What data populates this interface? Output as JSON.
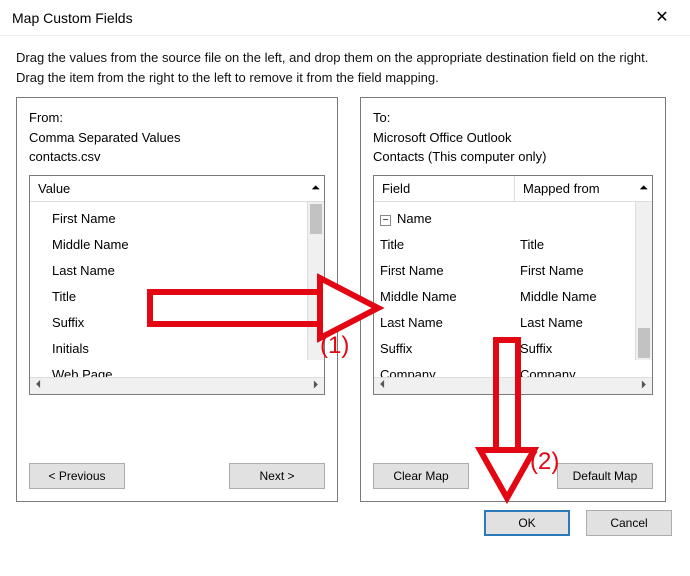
{
  "window": {
    "title": "Map Custom Fields",
    "close_icon": "✕"
  },
  "instructions": "Drag the values from the source file on the left, and drop them on the appropriate destination field on the right.  Drag the item from the right to the left to remove it from the field mapping.",
  "from": {
    "label": "From:",
    "format": "Comma Separated Values",
    "file": "contacts.csv",
    "col_header": "Value",
    "items": [
      "First Name",
      "Middle Name",
      "Last Name",
      "Title",
      "Suffix",
      "Initials",
      "Web Page"
    ]
  },
  "to": {
    "label": "To:",
    "app": "Microsoft Office Outlook",
    "folder": "Contacts (This computer only)",
    "col_field": "Field",
    "col_mapped": "Mapped from",
    "root": "Name",
    "rows": [
      {
        "field": "Title",
        "mapped": "Title"
      },
      {
        "field": "First Name",
        "mapped": "First Name"
      },
      {
        "field": "Middle Name",
        "mapped": "Middle Name"
      },
      {
        "field": "Last Name",
        "mapped": "Last Name"
      },
      {
        "field": "Suffix",
        "mapped": "Suffix"
      },
      {
        "field": "Company",
        "mapped": "Company"
      }
    ]
  },
  "buttons": {
    "prev": "< Previous",
    "next": "Next >",
    "clear": "Clear Map",
    "default": "Default Map",
    "ok": "OK",
    "cancel": "Cancel"
  },
  "annotations": {
    "a1": "(1)",
    "a2": "(2)",
    "color": "#e30613"
  },
  "scroll": {
    "up": "⏶",
    "down": "⏷",
    "left": "⏴",
    "right": "⏵"
  }
}
